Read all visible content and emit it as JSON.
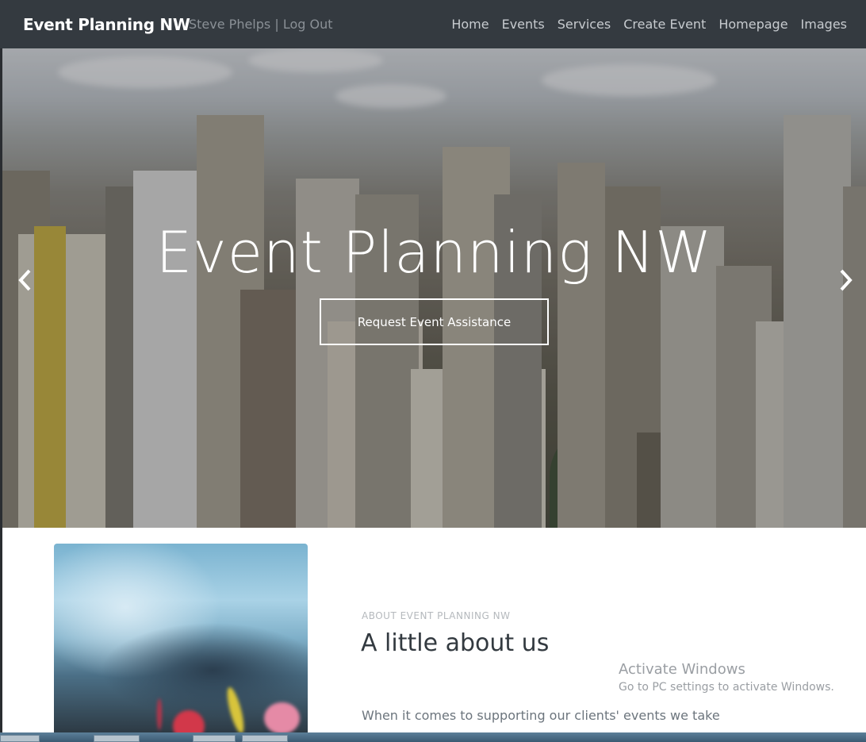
{
  "navbar": {
    "brand": "Event Planning NW",
    "user_name": "Steve Phelps",
    "separator": "|",
    "logout_label": "Log Out",
    "links": [
      "Home",
      "Events",
      "Services",
      "Create Event",
      "Homepage",
      "Images"
    ]
  },
  "hero": {
    "title": "Event Planning NW",
    "cta_label": "Request Event Assistance",
    "prev_icon": "chevron-left-icon",
    "next_icon": "chevron-right-icon"
  },
  "about": {
    "kicker": "ABOUT EVENT PLANNING NW",
    "heading": "A little about us",
    "text": "When it comes to supporting our clients' events we take our"
  },
  "watermark": {
    "line1": "Activate Windows",
    "line2": "Go to PC settings to activate Windows."
  },
  "colors": {
    "navbar_bg": "#343a40",
    "brand": "#ffffff",
    "nav_link": "#c7cbcf",
    "heading": "#333a40"
  }
}
